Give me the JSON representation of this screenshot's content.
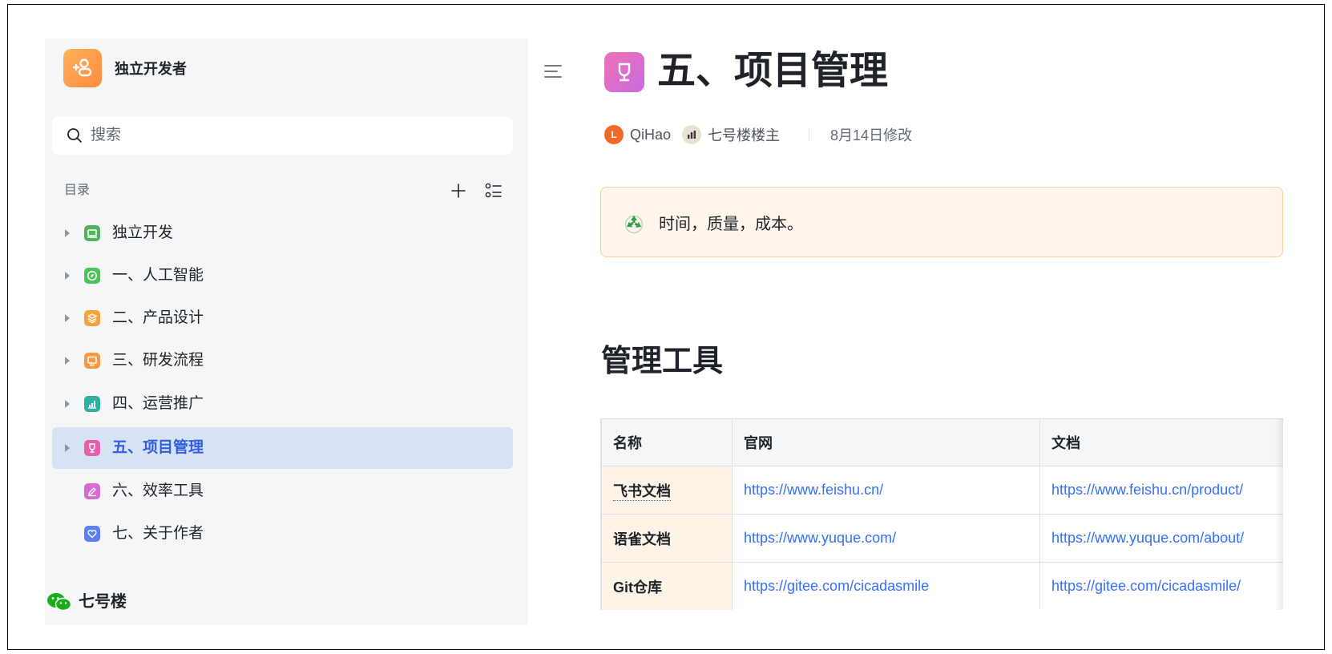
{
  "sidebar": {
    "workspace_title": "独立开发者",
    "search_placeholder": "搜索",
    "toc_label": "目录",
    "items": [
      {
        "label": "独立开发",
        "icon": "laptop-icon",
        "color": "#52b35c",
        "expandable": true
      },
      {
        "label": "一、人工智能",
        "icon": "compass-icon",
        "color": "#4fc25b",
        "expandable": true
      },
      {
        "label": "二、产品设计",
        "icon": "layers-icon",
        "color": "#f7a23b",
        "expandable": true
      },
      {
        "label": "三、研发流程",
        "icon": "monitor-icon",
        "color": "#f79a42",
        "expandable": true
      },
      {
        "label": "四、运营推广",
        "icon": "chart-icon",
        "color": "#2fb0a0",
        "expandable": true
      },
      {
        "label": "五、项目管理",
        "icon": "trophy-icon",
        "color": "#e35fb0",
        "expandable": true,
        "selected": true
      },
      {
        "label": "六、效率工具",
        "icon": "edit-icon",
        "color": "#d86bcf",
        "expandable": false
      },
      {
        "label": "七、关于作者",
        "icon": "heart-icon",
        "color": "#5e7ef2",
        "expandable": false
      }
    ],
    "footer_label": "七号楼"
  },
  "doc": {
    "title": "五、项目管理",
    "authors": [
      {
        "initial": "L",
        "name": "QiHao"
      },
      {
        "name": "七号楼楼主"
      }
    ],
    "modified": "8月14日修改",
    "callout": "时间，质量，成本。",
    "heading": "管理工具",
    "table": {
      "headers": [
        "名称",
        "官网",
        "文档"
      ],
      "rows": [
        [
          "飞书文档",
          "https://www.feishu.cn/",
          "https://www.feishu.cn/product/"
        ],
        [
          "语雀文档",
          "https://www.yuque.com/",
          "https://www.yuque.com/about/"
        ],
        [
          "Git仓库",
          "https://gitee.com/cicadasmile",
          "https://gitee.com/cicadasmile/"
        ]
      ]
    }
  },
  "colors": {
    "accent": "#3370ff",
    "selected_bg": "#d8e2f5",
    "callout_bg": "#fff5eb",
    "callout_border": "#fbcf99"
  }
}
